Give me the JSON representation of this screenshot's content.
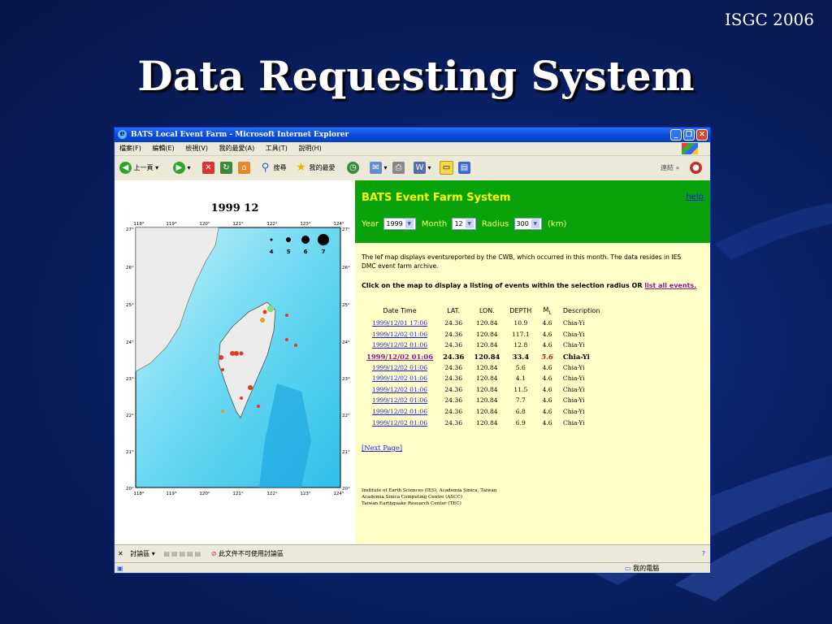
{
  "slide": {
    "tag": "ISGC 2006",
    "title": "Data Requesting System"
  },
  "browser": {
    "window_title": "BATS Local Event Farm - Microsoft Internet Explorer",
    "menu": [
      "檔案(F)",
      "編輯(E)",
      "檢視(V)",
      "我的最愛(A)",
      "工具(T)",
      "說明(H)"
    ],
    "toolbar": {
      "back": "上一頁",
      "search": "搜尋",
      "favorites": "我的最愛",
      "links": "連結"
    },
    "discuss_bar": {
      "label": "討論區",
      "message": "此文件不可使用討論區"
    },
    "status": {
      "zone": "我的電腦"
    }
  },
  "map": {
    "title": "1999 12",
    "lon_ticks": [
      "118°",
      "119°",
      "120°",
      "121°",
      "122°",
      "123°",
      "124°"
    ],
    "lat_ticks": [
      "27°",
      "26°",
      "25°",
      "24°",
      "23°",
      "22°",
      "21°",
      "20°"
    ],
    "magnitude_legend": [
      "4",
      "5",
      "6",
      "7"
    ],
    "colors": {
      "land": "#e8e8e8",
      "shallow": "#9ee8f4",
      "deep": "#35c5ee",
      "event": "#e23a1a"
    }
  },
  "app": {
    "title": "BATS Event Farm System",
    "help": "help",
    "year_label": "Year",
    "year_value": "1999",
    "month_label": "Month",
    "month_value": "12",
    "radius_label": "Radius",
    "radius_value": "300",
    "unit_label": "(km)",
    "intro_text": "The lef map displays eventsreported by the CWB, which occurred in this month. The data resides in IES DMC event farm archive.",
    "instruction_text": "Click on the map to display a listing of events within the selection radius OR ",
    "list_all": "list all events.",
    "table": {
      "headers": {
        "datetime": "Date Time",
        "lat": "LAT.",
        "lon": "LON.",
        "depth": "DEPTH",
        "ml": "M",
        "ml_sub": "L",
        "desc": "Description"
      },
      "rows": [
        {
          "datetime": "1999/12/01 17:06",
          "lat": "24.36",
          "lon": "120.84",
          "depth": "10.9",
          "ml": "4.6",
          "desc": "Chia-Yi"
        },
        {
          "datetime": "1999/12/02 01:06",
          "lat": "24.36",
          "lon": "120.84",
          "depth": "117.1",
          "ml": "4.6",
          "desc": "Chia-Yi"
        },
        {
          "datetime": "1999/12/02 01:06",
          "lat": "24.36",
          "lon": "120.84",
          "depth": "12.8",
          "ml": "4.6",
          "desc": "Chia-Yi"
        },
        {
          "datetime": "1999/12/02 01:06",
          "lat": "24.36",
          "lon": "120.84",
          "depth": "33.4",
          "ml": "5.6",
          "desc": "Chia-Yi",
          "highlight": true
        },
        {
          "datetime": "1999/12/02 01:06",
          "lat": "24.36",
          "lon": "120.84",
          "depth": "5.6",
          "ml": "4.6",
          "desc": "Chia-Yi"
        },
        {
          "datetime": "1999/12/02 01:06",
          "lat": "24.36",
          "lon": "120.84",
          "depth": "4.1",
          "ml": "4.6",
          "desc": "Chia-Yi"
        },
        {
          "datetime": "1999/12/02 01:06",
          "lat": "24.36",
          "lon": "120.84",
          "depth": "11.5",
          "ml": "4.6",
          "desc": "Chia-Yi"
        },
        {
          "datetime": "1999/12/02 01:06",
          "lat": "24.36",
          "lon": "120.84",
          "depth": "7.7",
          "ml": "4.6",
          "desc": "Chia-Yi"
        },
        {
          "datetime": "1999/12/02 01:06",
          "lat": "24.36",
          "lon": "120.84",
          "depth": "6.8",
          "ml": "4.6",
          "desc": "Chia-Yi"
        },
        {
          "datetime": "1999/12/02 01:06",
          "lat": "24.36",
          "lon": "120.84",
          "depth": "6.9",
          "ml": "4.6",
          "desc": "Chia-Yi"
        }
      ]
    },
    "next_page": "[Next Page]",
    "credits": [
      "Institute of Earth Sciences (IES), Academia Sinica, Taiwan",
      "Academia Sinica Computing Centre (ASCC)",
      "Taiwan Earthquake Research Center (TEC)"
    ]
  }
}
